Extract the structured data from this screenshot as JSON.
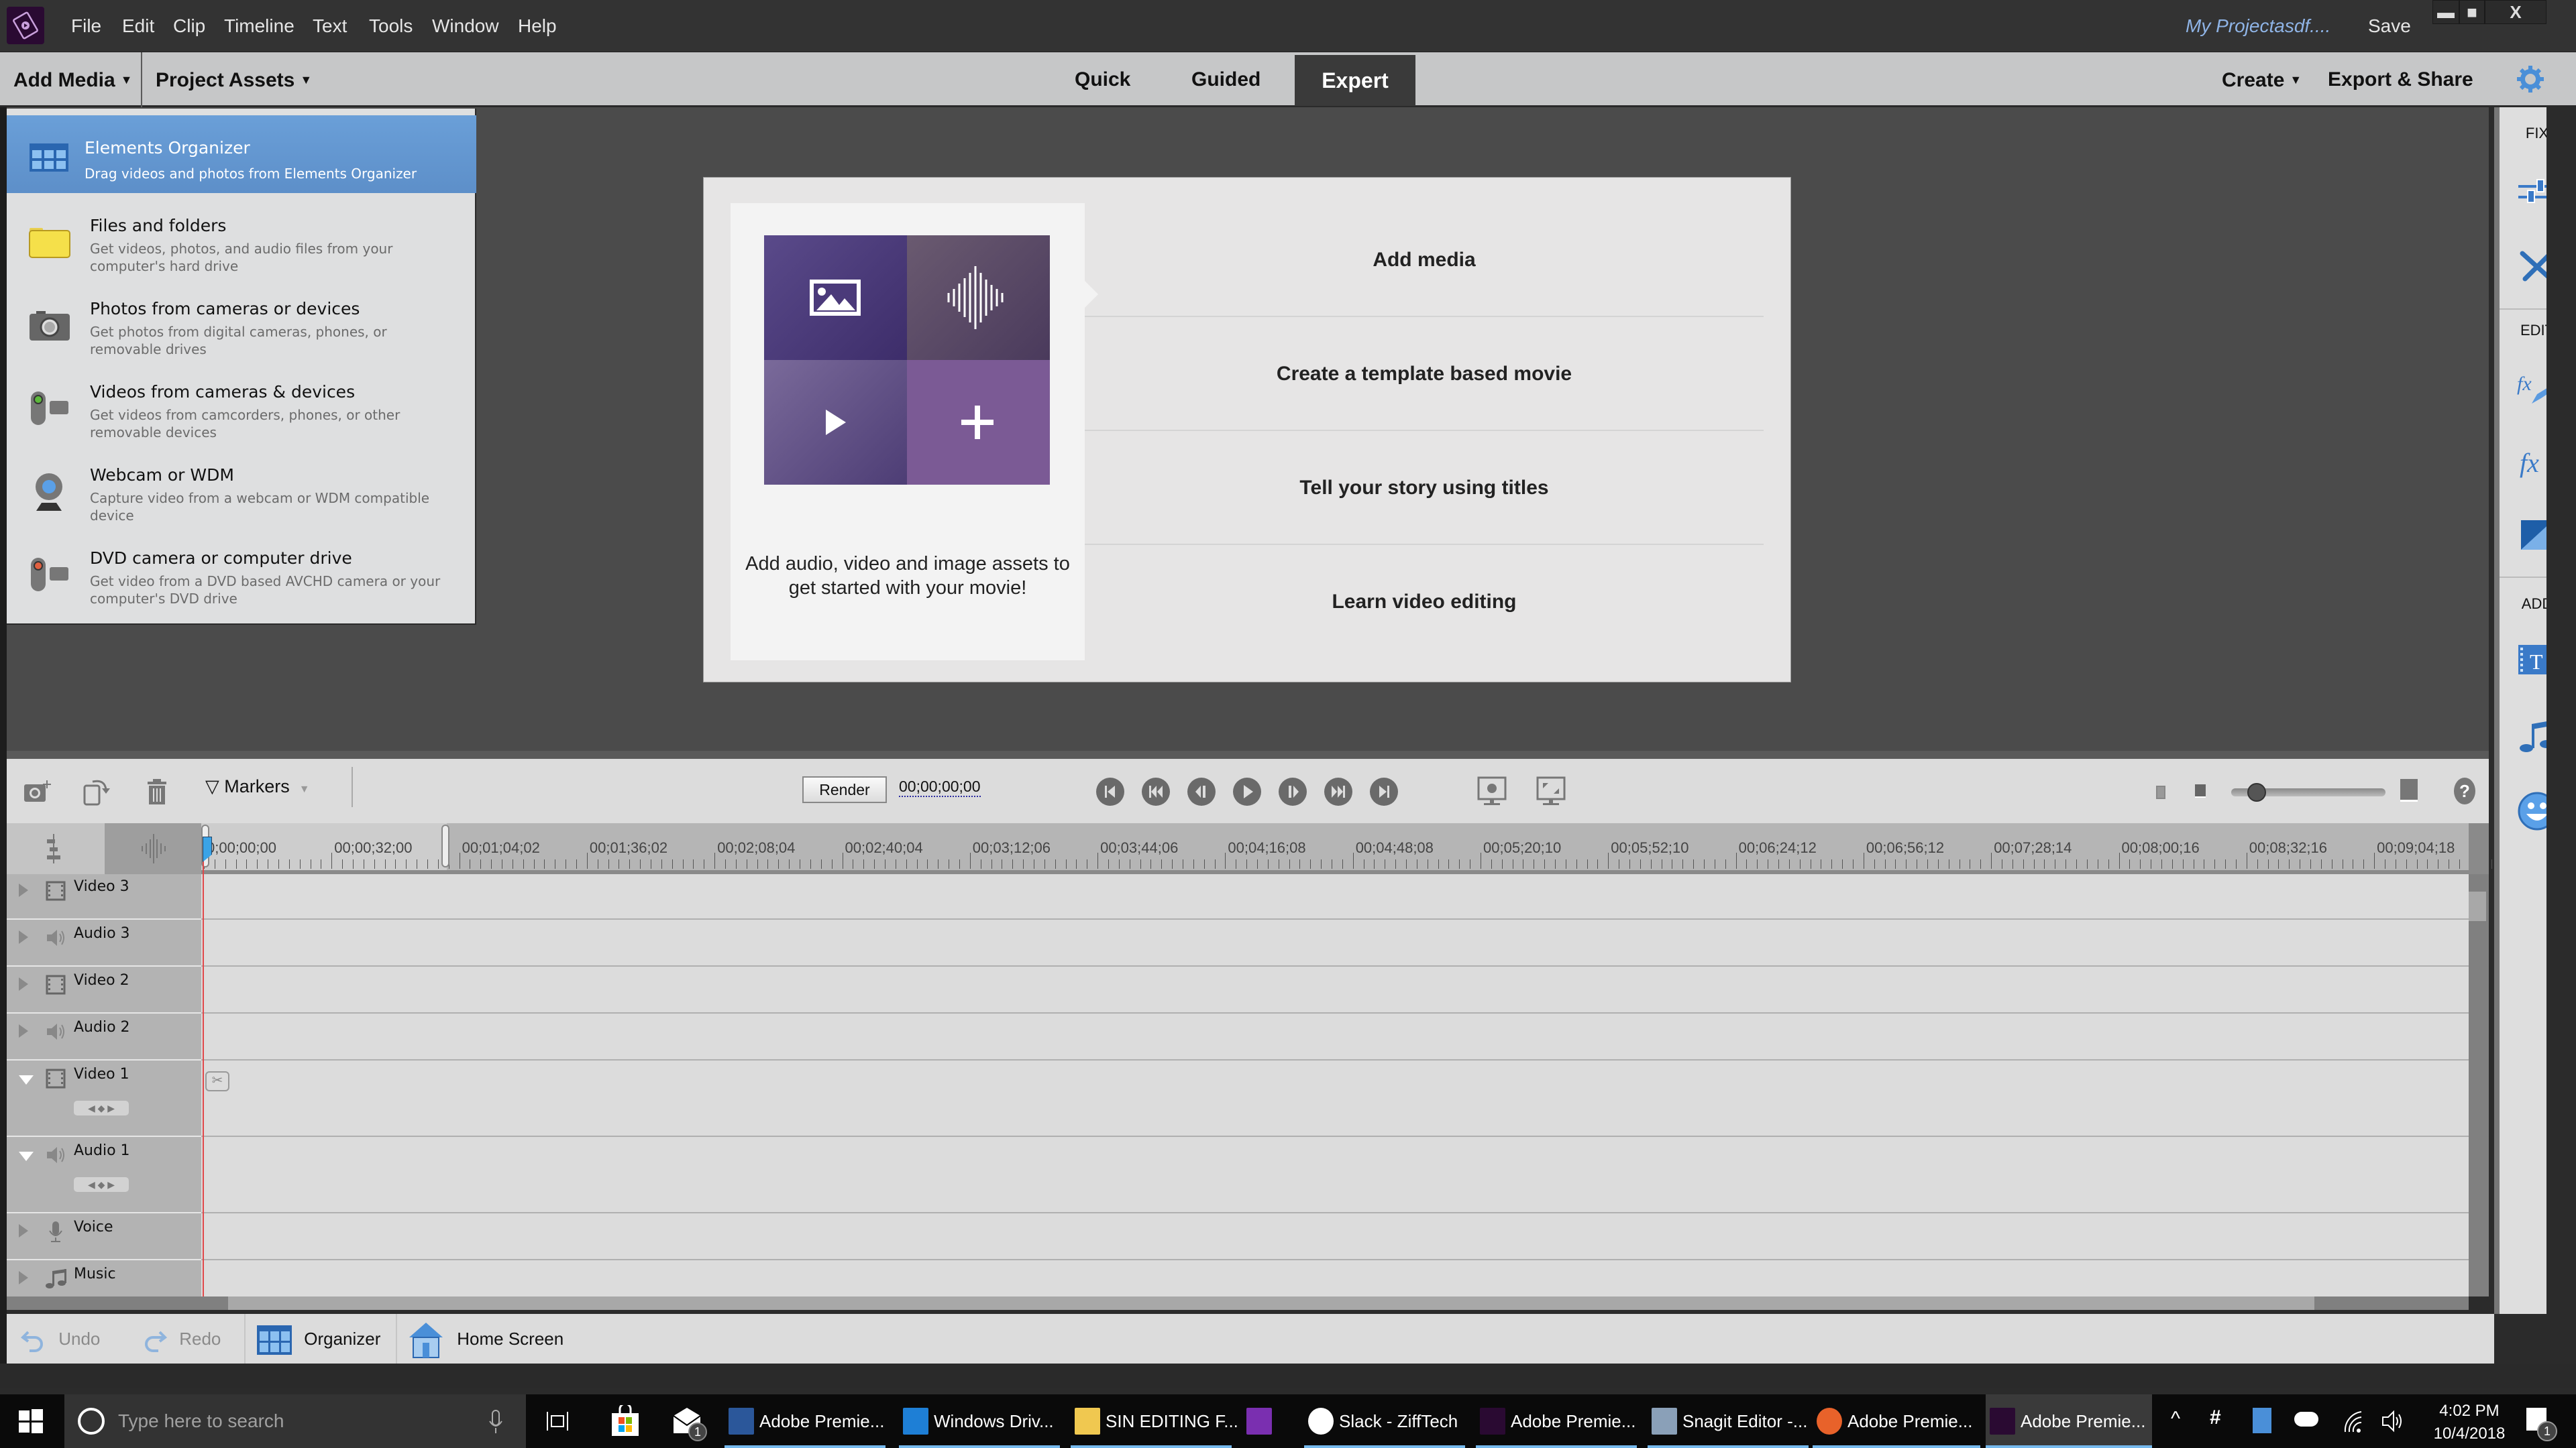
{
  "app": {
    "menu": [
      "File",
      "Edit",
      "Clip",
      "Timeline",
      "Text",
      "Tools",
      "Window",
      "Help"
    ],
    "project_name": "My Projectasdf....",
    "save_label": "Save",
    "window_controls": {
      "minimize": "▬",
      "maximize": "■",
      "close": "X"
    }
  },
  "modebar": {
    "add_media": "Add Media",
    "project_assets": "Project Assets",
    "tabs": [
      "Quick",
      "Guided",
      "Expert"
    ],
    "active_tab": "Expert",
    "create": "Create",
    "export_share": "Export & Share",
    "settings_icon": "gear-icon"
  },
  "add_media_menu": {
    "items": [
      {
        "title": "Elements Organizer",
        "desc": "Drag videos and photos from Elements Organizer",
        "icon": "organizer-grid-icon",
        "selected": true
      },
      {
        "title": "Files and folders",
        "desc": "Get videos, photos, and audio files from your computer's hard drive",
        "icon": "folder-icon"
      },
      {
        "title": "Photos from cameras or devices",
        "desc": "Get photos from digital cameras, phones, or removable drives",
        "icon": "camera-icon"
      },
      {
        "title": "Videos from cameras & devices",
        "desc": "Get videos from camcorders, phones, or other removable devices",
        "icon": "camcorder-icon"
      },
      {
        "title": "Webcam or WDM",
        "desc": "Capture video from a webcam or WDM compatible device",
        "icon": "webcam-icon"
      },
      {
        "title": "DVD camera or computer drive",
        "desc": "Get video from a DVD based AVCHD camera or your computer's DVD drive",
        "icon": "dvd-camera-icon"
      }
    ]
  },
  "welcome": {
    "caption": "Add audio, video and image assets to get started with your movie!",
    "options": [
      "Add media",
      "Create a template based movie",
      "Tell your story using titles",
      "Learn video editing"
    ],
    "accent": "#7b5a95"
  },
  "right_panel": {
    "sections": [
      {
        "label": "FIX",
        "icons": [
          "adjustments-sliders-icon",
          "tools-wrench-screwdriver-icon"
        ]
      },
      {
        "label": "EDIT",
        "icons": [
          "fx-edit-icon",
          "fx-icon",
          "transitions-icon"
        ]
      },
      {
        "label": "ADD",
        "icons": [
          "titles-icon",
          "music-note-icon",
          "graphics-smiley-icon"
        ]
      }
    ]
  },
  "timeline": {
    "markers_label": "Markers",
    "render_label": "Render",
    "timecode": "00;00;00;00",
    "zoom_level": 0.1,
    "ruler": [
      "0;00;00;00",
      "00;00;32;00",
      "00;01;04;02",
      "00;01;36;02",
      "00;02;08;04",
      "00;02;40;04",
      "00;03;12;06",
      "00;03;44;06",
      "00;04;16;08",
      "00;04;48;08",
      "00;05;20;10",
      "00;05;52;10",
      "00;06;24;12",
      "00;06;56;12",
      "00;07;28;14",
      "00;08;00;16",
      "00;08;32;16",
      "00;09;04;18"
    ],
    "tracks": [
      {
        "name": "Video 3",
        "type": "video",
        "expanded": false
      },
      {
        "name": "Audio 3",
        "type": "audio",
        "expanded": false
      },
      {
        "name": "Video 2",
        "type": "video",
        "expanded": false
      },
      {
        "name": "Audio 2",
        "type": "audio",
        "expanded": false
      },
      {
        "name": "Video 1",
        "type": "video",
        "expanded": true
      },
      {
        "name": "Audio 1",
        "type": "audio",
        "expanded": true
      },
      {
        "name": "Voice",
        "type": "voice",
        "expanded": false
      },
      {
        "name": "Music",
        "type": "music",
        "expanded": false
      }
    ]
  },
  "bottombar": {
    "undo": "Undo",
    "redo": "Redo",
    "organizer": "Organizer",
    "home_screen": "Home Screen"
  },
  "taskbar": {
    "search_placeholder": "Type here to search",
    "mail_badge": "1",
    "items": [
      {
        "label": "Adobe Premie...",
        "icon": "word-icon"
      },
      {
        "label": "Windows Driv...",
        "icon": "edge-icon"
      },
      {
        "label": "SIN EDITING F...",
        "icon": "file-explorer-icon"
      },
      {
        "label": "",
        "icon": "onenote-icon"
      },
      {
        "label": "Slack - ZiffTech",
        "icon": "slack-icon"
      },
      {
        "label": "Adobe Premie...",
        "icon": "premiere-elements-icon"
      },
      {
        "label": "Snagit Editor -...",
        "icon": "snagit-icon"
      },
      {
        "label": "Adobe Premie...",
        "icon": "firefox-icon"
      },
      {
        "label": "Adobe Premie...",
        "icon": "premiere-elements-icon",
        "active": true
      }
    ],
    "time": "4:02 PM",
    "date": "10/4/2018",
    "notification_count": "1"
  }
}
